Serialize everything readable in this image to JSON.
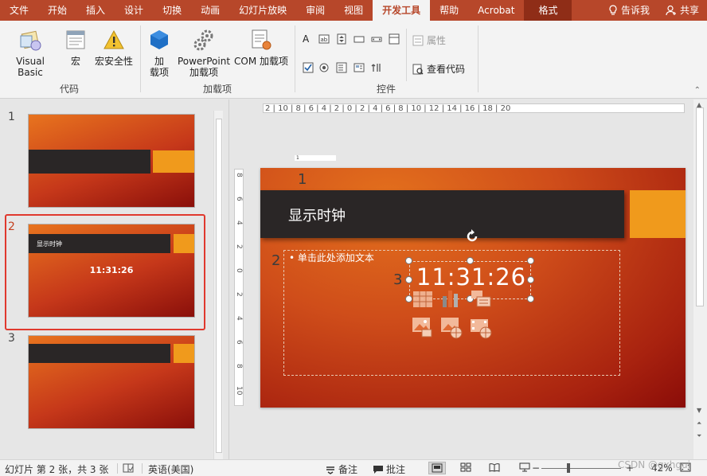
{
  "tabs": [
    {
      "label": "文件"
    },
    {
      "label": "开始"
    },
    {
      "label": "插入"
    },
    {
      "label": "设计"
    },
    {
      "label": "切换"
    },
    {
      "label": "动画"
    },
    {
      "label": "幻灯片放映"
    },
    {
      "label": "审阅"
    },
    {
      "label": "视图"
    },
    {
      "label": "开发工具",
      "active": true
    },
    {
      "label": "帮助"
    },
    {
      "label": "Acrobat"
    },
    {
      "label": "格式"
    }
  ],
  "tell_me": "告诉我",
  "share": "共享",
  "ribbon": {
    "code_group": {
      "label": "代码",
      "visual_basic": "Visual Basic",
      "macro": "宏",
      "macro_security": "宏安全性"
    },
    "addins_group": {
      "label": "加载项",
      "addins_line1": "加",
      "addins_line2": "载项",
      "ppt_addins_line1": "PowerPoint",
      "ppt_addins_line2": "加载项",
      "com_addins": "COM 加载项"
    },
    "controls_group": {
      "label": "控件",
      "properties": "属性",
      "view_code": "查看代码"
    }
  },
  "slides_panel": [
    {
      "number": "1"
    },
    {
      "number": "2",
      "title": "显示时钟",
      "clock": "11:31:26",
      "selected": true
    },
    {
      "number": "3"
    }
  ],
  "ruler": {
    "horizontal": "2 | 10 | 8 | 6 | 4 | 2 | 0 | 2 | 4 | 6 | 8 | 10 | 12 | 14 | 16 | 18 | 20",
    "vertical": [
      "8",
      "6",
      "4",
      "2",
      "0",
      "2",
      "4",
      "6",
      "8",
      "10"
    ]
  },
  "small_box_text": "1",
  "slide": {
    "title": "显示时钟",
    "tag_1": "1",
    "tag_2": "2",
    "tag_3": "3",
    "content_hint": "• 单击此处添加文本",
    "clock": "11:31:26"
  },
  "status": {
    "slide_info": "幻灯片 第 2 张，共 3 张",
    "language": "英语(美国)",
    "notes": "备注",
    "comments": "批注",
    "zoom": "42%",
    "watermark": "CSDN @gxhgui"
  },
  "colors": {
    "ribbon_tab_bg": "#b7472a",
    "slide_orange": "#e4711d",
    "slide_dark_red": "#8a0c08",
    "title_bar": "#2a2626",
    "accent": "#f09a1c",
    "selection": "#e0392e"
  }
}
